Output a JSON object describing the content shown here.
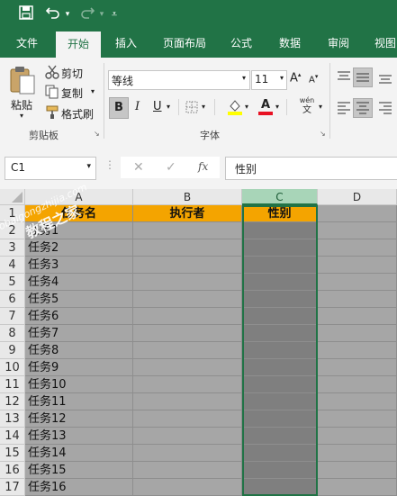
{
  "qat": {
    "save_icon": "save-icon",
    "undo_icon": "undo-icon",
    "redo_icon": "redo-icon",
    "customize_icon": "customize-icon"
  },
  "tabs": [
    "文件",
    "开始",
    "插入",
    "页面布局",
    "公式",
    "数据",
    "审阅",
    "视图"
  ],
  "active_tab": "开始",
  "clipboard": {
    "paste": "粘贴",
    "cut": "剪切",
    "copy": "复制",
    "format_painter": "格式刷",
    "group": "剪贴板"
  },
  "font": {
    "name": "等线",
    "size": "11",
    "group": "字体",
    "bold": "B",
    "italic": "I",
    "underline": "U",
    "phonetic": "wén",
    "phonetic_sub": "文",
    "font_color_letter": "A",
    "grow": "A",
    "shrink": "A"
  },
  "formula_bar": {
    "name_box": "C1",
    "fx": "fx",
    "value": "性别"
  },
  "columns": [
    "A",
    "B",
    "C",
    "D"
  ],
  "header_row": [
    "任务名",
    "执行者",
    "性别"
  ],
  "rows": [
    {
      "n": "1"
    },
    {
      "n": "2",
      "a": "任务1"
    },
    {
      "n": "3",
      "a": "任务2"
    },
    {
      "n": "4",
      "a": "任务3"
    },
    {
      "n": "5",
      "a": "任务4"
    },
    {
      "n": "6",
      "a": "任务5"
    },
    {
      "n": "7",
      "a": "任务6"
    },
    {
      "n": "8",
      "a": "任务7"
    },
    {
      "n": "9",
      "a": "任务8"
    },
    {
      "n": "10",
      "a": "任务9"
    },
    {
      "n": "11",
      "a": "任务10"
    },
    {
      "n": "12",
      "a": "任务11"
    },
    {
      "n": "13",
      "a": "任务12"
    },
    {
      "n": "14",
      "a": "任务13"
    },
    {
      "n": "15",
      "a": "任务14"
    },
    {
      "n": "16",
      "a": "任务15"
    },
    {
      "n": "17",
      "a": "任务16"
    }
  ],
  "watermark": {
    "line1": "Xiaobaigongzhijia.com",
    "line2": "教程之家"
  },
  "colors": {
    "accent": "#217346",
    "header_fill": "#f4a400",
    "cell_fill": "#a6a6a6",
    "selected_col": "#7f7f7f"
  }
}
